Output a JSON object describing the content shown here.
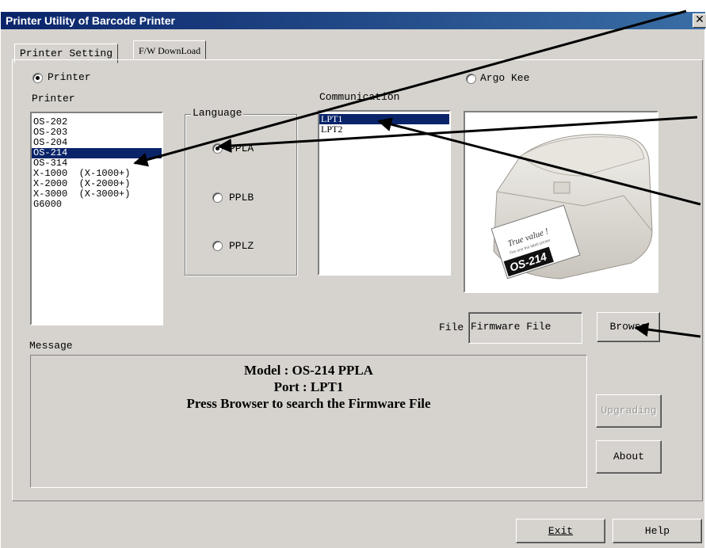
{
  "window": {
    "title": "Printer Utility of Barcode Printer",
    "close_symbol": "✕"
  },
  "tabs": [
    {
      "label": "Printer Setting",
      "selected": false
    },
    {
      "label": "F/W DownLoad",
      "selected": true
    }
  ],
  "brand_radios": [
    {
      "label": "Printer",
      "checked": true
    },
    {
      "label": "Argo Kee",
      "checked": false
    }
  ],
  "printer_list": {
    "label": "Printer",
    "items": [
      "OS-202",
      "OS-203",
      "OS-204",
      "OS-214",
      "OS-314",
      "X-1000  (X-1000+)",
      "X-2000  (X-2000+)",
      "X-3000  (X-3000+)",
      "G6000"
    ],
    "selected": "OS-214"
  },
  "language": {
    "label": "Language",
    "options": [
      {
        "label": "PPLA",
        "checked": true
      },
      {
        "label": "PPLB",
        "checked": false
      },
      {
        "label": "PPLZ",
        "checked": false
      }
    ]
  },
  "communication": {
    "label": "Communication",
    "items": [
      "LPT1",
      "LPT2"
    ],
    "selected": "LPT1"
  },
  "printer_image": {
    "caption_line1": "True value !",
    "caption_line2": "The one the label printer",
    "model_badge": "OS-214"
  },
  "file": {
    "label": "File",
    "value": "Firmware File"
  },
  "buttons": {
    "browse": "Browse",
    "upgrading": "Upgrading",
    "about": "About",
    "exit": "Exit",
    "help": "Help"
  },
  "message": {
    "label": "Message",
    "lines": [
      "Model : OS-214 PPLA",
      "Port : LPT1",
      "Press Browser to search the Firmware File"
    ]
  },
  "colors": {
    "face": "#d6d3ce",
    "selection": "#0a246a",
    "title_start": "#0a246a",
    "title_end": "#3a6ea5"
  }
}
